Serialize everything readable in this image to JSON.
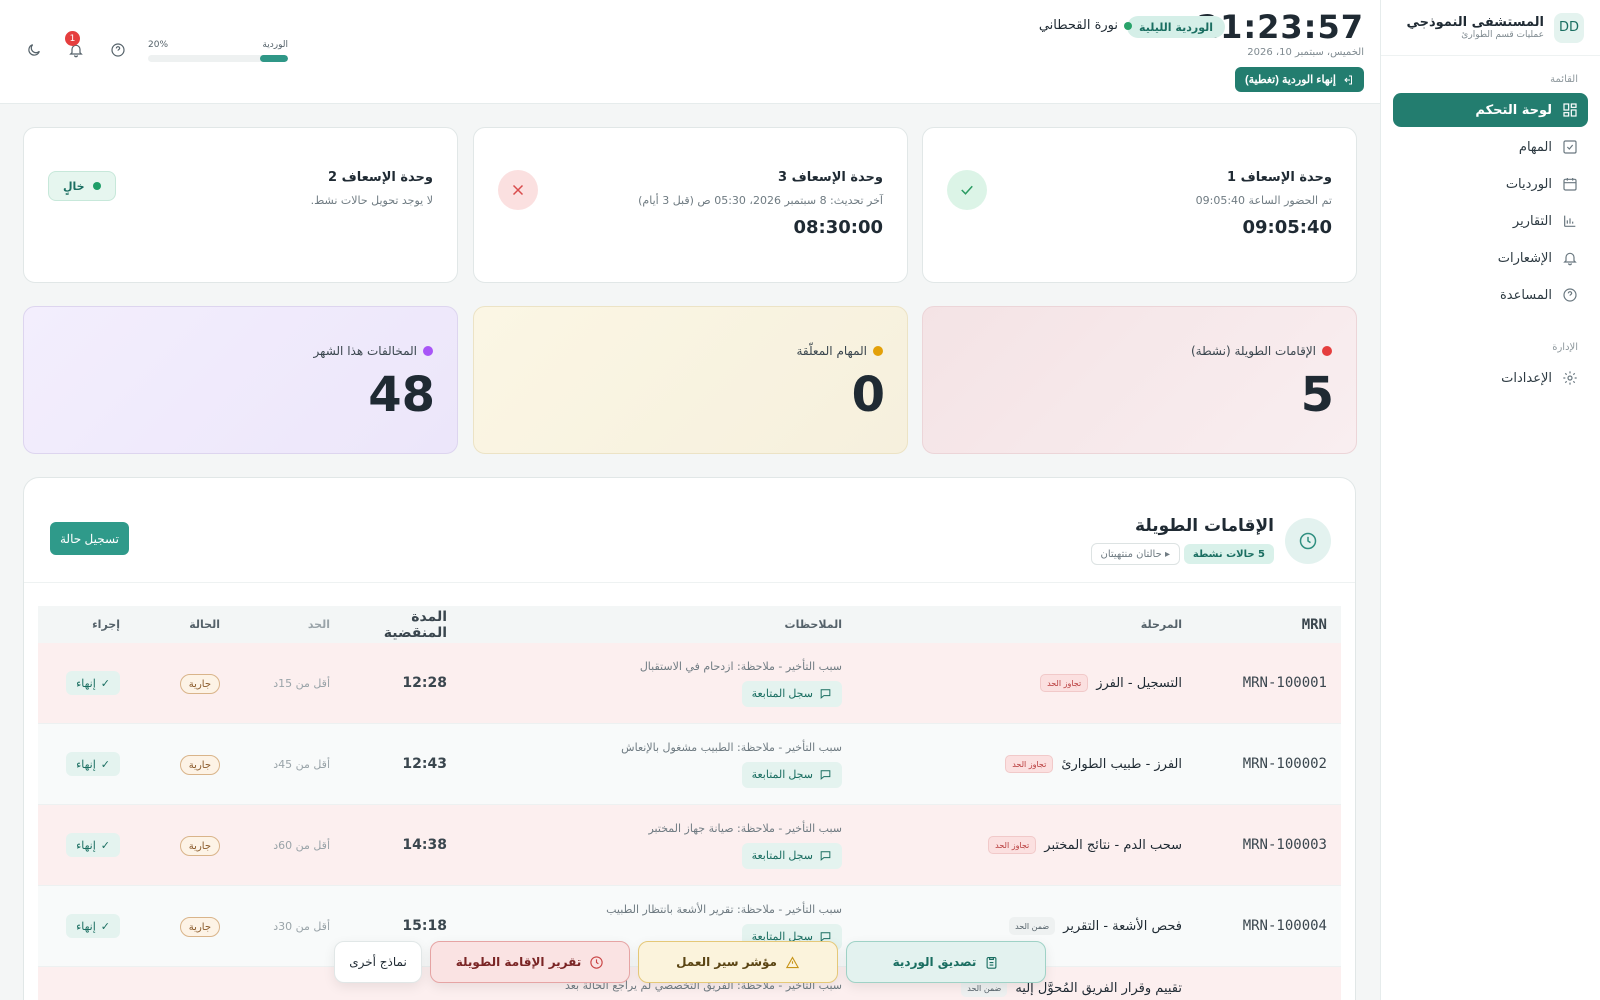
{
  "sidebar": {
    "brand_initials": "DD",
    "brand_name": "المستشفى النموذجي",
    "brand_sub": "عمليات قسم الطوارئ",
    "section_menu": "القائمة",
    "section_admin": "الإدارة",
    "items": [
      {
        "label": "لوحة التحكم",
        "icon": "dashboard-icon",
        "active": true
      },
      {
        "label": "المهام",
        "icon": "checkbox-icon"
      },
      {
        "label": "الورديات",
        "icon": "calendar-icon"
      },
      {
        "label": "التقارير",
        "icon": "chart-icon"
      },
      {
        "label": "الإشعارات",
        "icon": "bell-icon"
      },
      {
        "label": "المساعدة",
        "icon": "help-icon"
      }
    ],
    "admin_items": [
      {
        "label": "الإعدادات",
        "icon": "gear-icon"
      }
    ]
  },
  "header": {
    "clock": "21:23:57",
    "date": "الخميس، سبتمبر 10، 2026",
    "end_shift": "إنهاء الوردية (تغطية)",
    "shift_pill": "الوردية الليلية",
    "user": "نورة القحطاني",
    "progress_label": "الوردية",
    "progress_text": "20%",
    "progress_value": 0.2,
    "notifications_count": "1"
  },
  "units": [
    {
      "title": "وحدة الإسعاف 1",
      "sub": "تم الحضور الساعة 09:05:40",
      "time": "09:05:40",
      "status": "ok"
    },
    {
      "title": "وحدة الإسعاف 3",
      "sub": "آخر تحديث: 8 سبتمبر 2026، 05:30 ص (قبل 3 أيام)",
      "time": "08:30:00",
      "status": "bad"
    },
    {
      "title": "وحدة الإسعاف 2",
      "sub": "لا يوجد تحويل حالات نشط.",
      "status": "free",
      "status_label": "خالٍ"
    }
  ],
  "stats": [
    {
      "label": "الإقامات الطويلة (نشطة)",
      "value": "5",
      "color": "#e53e3e"
    },
    {
      "label": "المهام المعلّقة",
      "value": "0",
      "color": "#e3a008"
    },
    {
      "label": "المخالفات هذا الشهر",
      "value": "48",
      "color": "#a855f7"
    }
  ],
  "long_stays": {
    "title": "الإقامات الطويلة",
    "active_pill": "5 حالات نشطة",
    "ended_pill": "▸ حالتان منتهيتان",
    "add_button": "تسجيل حالة",
    "columns": [
      "MRN",
      "المرحلة",
      "الملاحظات",
      "المدة المنقضية",
      "الحد",
      "الحالة",
      "إجراء"
    ],
    "rows": [
      {
        "mrn": "MRN-100001",
        "stage": "التسجيل - الفرز",
        "tag": "تجاوز الحد",
        "note": "سبب التأخير - ملاحظة: ازدحام في الاستقبال",
        "follow": "سجل المتابعة",
        "elapsed": "12:28",
        "limit": "أقل من 15د",
        "status": "جارية",
        "action": "إنهاء",
        "kind": "over"
      },
      {
        "mrn": "MRN-100002",
        "stage": "الفرز - طبيب الطوارئ",
        "tag": "تجاوز الحد",
        "note": "سبب التأخير - ملاحظة: الطبيب مشغول بالإنعاش",
        "follow": "سجل المتابعة",
        "elapsed": "12:43",
        "limit": "أقل من 45د",
        "status": "جارية",
        "action": "إنهاء",
        "kind": "within"
      },
      {
        "mrn": "MRN-100003",
        "stage": "سحب الدم - نتائج المختبر",
        "tag": "تجاوز الحد",
        "note": "سبب التأخير - ملاحظة: صيانة جهاز المختبر",
        "follow": "سجل المتابعة",
        "elapsed": "14:38",
        "limit": "أقل من 60د",
        "status": "جارية",
        "action": "إنهاء",
        "kind": "over"
      },
      {
        "mrn": "MRN-100004",
        "stage": "فحص الأشعة - التقرير",
        "tag": "ضمن الحد",
        "note": "سبب التأخير - ملاحظة: تقرير الأشعة بانتظار الطبيب",
        "follow": "سجل المتابعة",
        "elapsed": "15:18",
        "limit": "أقل من 30د",
        "status": "جارية",
        "action": "إنهاء",
        "kind": "within"
      },
      {
        "mrn": "",
        "stage": "تقييم وقرار الفريق المُحوَّل إليه",
        "tag": "ضمن الحد",
        "note": "سبب التأخير - ملاحظة: الفريق التخصصي لم يراجع الحالة بعد",
        "follow": "",
        "elapsed": "",
        "limit": "",
        "status": "",
        "action": "",
        "kind": "over"
      }
    ]
  },
  "bottom_bar": {
    "shift_confirm": "تصديق الوردية",
    "workflow": "مؤشر سير العمل",
    "long_stay_report": "تقرير الإقامة الطويلة",
    "other_forms": "نماذج أخرى"
  }
}
